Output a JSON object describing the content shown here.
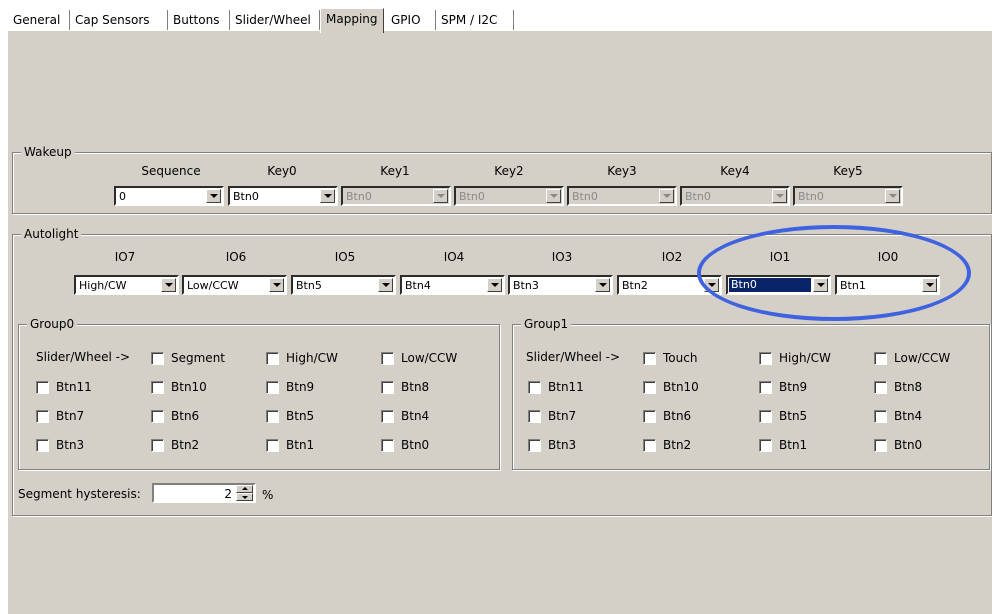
{
  "tabs": [
    "General",
    "Cap Sensors",
    "Buttons",
    "Slider/Wheel",
    "Mapping",
    "GPIO",
    "SPM / I2C"
  ],
  "active_tab": "Mapping",
  "wakeup": {
    "title": "Wakeup",
    "headers": [
      "Sequence",
      "Key0",
      "Key1",
      "Key2",
      "Key3",
      "Key4",
      "Key5"
    ],
    "values": [
      "0",
      "Btn0",
      "Btn0",
      "Btn0",
      "Btn0",
      "Btn0",
      "Btn0"
    ]
  },
  "autolight": {
    "title": "Autolight",
    "headers": [
      "IO7",
      "IO6",
      "IO5",
      "IO4",
      "IO3",
      "IO2",
      "IO1",
      "IO0"
    ],
    "values": [
      "High/CW",
      "Low/CCW",
      "Btn5",
      "Btn4",
      "Btn3",
      "Btn2",
      "Btn0",
      "Btn1"
    ]
  },
  "group0": {
    "title": "Group0",
    "slider_label": "Slider/Wheel ->",
    "slider_options": [
      "Segment",
      "High/CW",
      "Low/CCW"
    ],
    "rows": [
      [
        "Btn11",
        "Btn10",
        "Btn9",
        "Btn8"
      ],
      [
        "Btn7",
        "Btn6",
        "Btn5",
        "Btn4"
      ],
      [
        "Btn3",
        "Btn2",
        "Btn1",
        "Btn0"
      ]
    ]
  },
  "group1": {
    "title": "Group1",
    "slider_label": "Slider/Wheel ->",
    "slider_options": [
      "Touch",
      "High/CW",
      "Low/CCW"
    ],
    "rows": [
      [
        "Btn11",
        "Btn10",
        "Btn9",
        "Btn8"
      ],
      [
        "Btn7",
        "Btn6",
        "Btn5",
        "Btn4"
      ],
      [
        "Btn3",
        "Btn2",
        "Btn1",
        "Btn0"
      ]
    ]
  },
  "hysteresis": {
    "label": "Segment hysteresis:",
    "value": "2",
    "unit": "%"
  },
  "colors": {
    "panel": "#d4d0c8",
    "selection": "#0a246a",
    "highlight_ellipse": "#3f63e0"
  }
}
